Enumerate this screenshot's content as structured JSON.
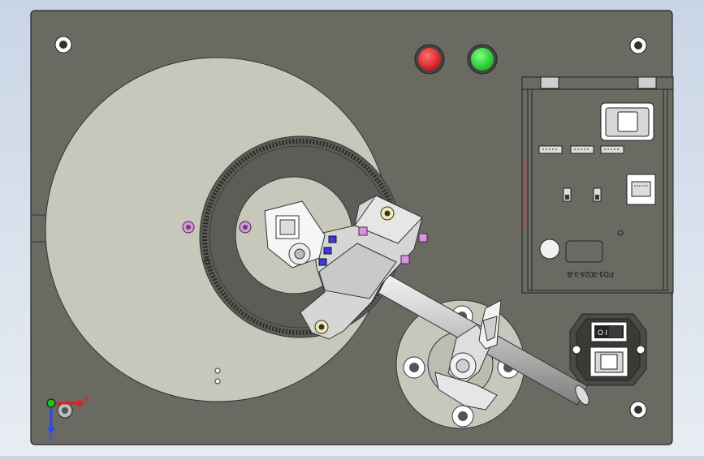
{
  "model": {
    "background_colors": [
      "#c9d5e6",
      "#e8edf3"
    ],
    "plate_color": "#6a6a62",
    "disc_color": "#c8c7bc",
    "ring_color": "#5d5d57",
    "indicators": [
      {
        "name": "red-indicator-light",
        "color": "#e02020"
      },
      {
        "name": "green-indicator-light",
        "color": "#19d426"
      }
    ],
    "module": {
      "label": "PD3-3024-3-B",
      "ports": [
        "rj45-port",
        "usb-port",
        "switch-1",
        "switch-2",
        "header-1",
        "header-2",
        "header-3"
      ]
    },
    "power_socket": {
      "switch_text": "O  I"
    },
    "triad": {
      "x_label": "X",
      "y_label": "Y"
    }
  }
}
